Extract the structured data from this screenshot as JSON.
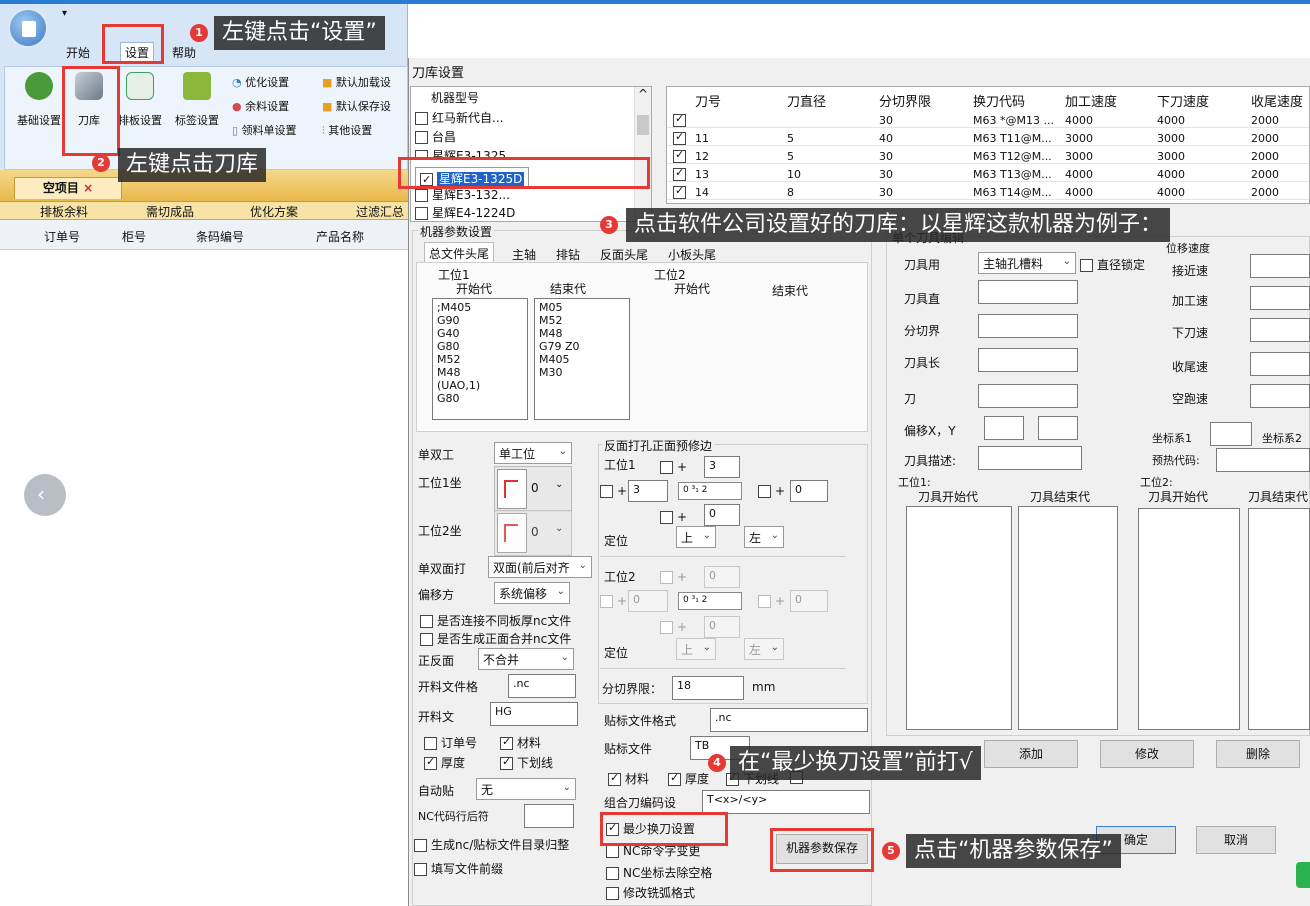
{
  "app": {
    "quick_access": "▾",
    "tabs": [
      "开始",
      "设置",
      "帮助"
    ],
    "ribbon": {
      "big_buttons": [
        {
          "label": "基础设置",
          "icon": "tools-icon",
          "color": "#4a9a3a"
        },
        {
          "label": "刀库",
          "icon": "cutter-icon",
          "color": "#6a7a8a"
        },
        {
          "label": "排板设置",
          "icon": "layout-icon",
          "color": "#3aa060"
        },
        {
          "label": "标签设置",
          "icon": "tag-icon",
          "color": "#8ab83a"
        }
      ],
      "small_buttons": [
        "优化设置",
        "余料设置",
        "领料单设置",
        "默认加载设",
        "默认保存设",
        "其他设置"
      ]
    },
    "doc_tab": {
      "label": "空项目",
      "close": "×"
    },
    "sub_tabs": [
      "排板余料",
      "需切成品",
      "优化方案",
      "过滤汇总"
    ],
    "columns": [
      "订单号",
      "柜号",
      "条码编号",
      "产品名称"
    ],
    "nav_prev": "‹"
  },
  "dialog": {
    "title": "刀库设置",
    "machine_list": {
      "header": "机器型号",
      "scroll_up": "^",
      "items": [
        {
          "label": "红马新代自...",
          "checked": false
        },
        {
          "label": "台昌",
          "checked": false
        },
        {
          "label": "星辉E3-1325",
          "checked": false
        },
        {
          "label": "星辉E3-1325D",
          "checked": true
        },
        {
          "label": "星辉E3-132...",
          "checked": false
        },
        {
          "label": "星辉E4-1224D",
          "checked": false
        }
      ]
    },
    "tool_grid": {
      "headers": [
        "刀号",
        "刀直径",
        "分切界限",
        "换刀代码",
        "加工速度",
        "下刀速度",
        "收尾速度"
      ],
      "rows": [
        {
          "checked": true,
          "no": "",
          "dia": "",
          "cut": "30",
          "code": "M63 *@M13 ...",
          "speed": "4000",
          "down": "4000",
          "end": "2000"
        },
        {
          "checked": true,
          "no": "11",
          "dia": "5",
          "cut": "40",
          "code": "M63 T11@M...",
          "speed": "3000",
          "down": "3000",
          "end": "2000"
        },
        {
          "checked": true,
          "no": "12",
          "dia": "5",
          "cut": "30",
          "code": "M63 T12@M...",
          "speed": "3000",
          "down": "3000",
          "end": "2000"
        },
        {
          "checked": true,
          "no": "13",
          "dia": "10",
          "cut": "30",
          "code": "M63 T13@M...",
          "speed": "4000",
          "down": "4000",
          "end": "2000"
        },
        {
          "checked": true,
          "no": "14",
          "dia": "8",
          "cut": "30",
          "code": "M63 T14@M...",
          "speed": "4000",
          "down": "4000",
          "end": "2000"
        }
      ]
    },
    "machine_params": {
      "title": "机器参数设置",
      "tabs": [
        "总文件头尾",
        "主轴",
        "排钻",
        "反面头尾",
        "小板头尾"
      ],
      "station1": "工位1",
      "station2": "工位2",
      "start_code": "开始代",
      "end_code": "结束代",
      "start_lines": ";M405\nG90\nG40\nG80\nM52\nM48\n(UAO,1)\nG80",
      "end_lines": "M05\nM52\nM48\nG79 Z0\nM405\nM30",
      "single_double_label": "单双工",
      "single_double_value": "单工位",
      "station1_coord": "工位1坐",
      "station2_coord": "工位2坐",
      "coord_value": "0",
      "face_label": "单双面打",
      "face_value": "双面(前后对齐",
      "offset_label": "偏移方",
      "offset_value": "系统偏移",
      "chk_connect": "是否连接不同板厚nc文件",
      "chk_merge": "是否生成正面合并nc文件",
      "front_back_label": "正反面",
      "front_back_value": "不合并",
      "open_fmt_label": "开料文件格",
      "open_fmt_value": ".nc",
      "open_file_label": "开料文",
      "open_file_value": "HG",
      "chk_order": "订单号",
      "chk_material": "材料",
      "chk_thickness": "厚度",
      "chk_underline": "下划线",
      "auto_label": "自动贴",
      "auto_value": "无",
      "nc_suffix_label": "NC代码行后符",
      "chk_gen_dir": "生成nc/贴标文件目录归整",
      "chk_prefix": "填写文件前缀"
    },
    "back_panel": {
      "title": "反面打孔正面预修边",
      "st1": "工位1",
      "st2": "工位2",
      "plus": "+",
      "v_top": "3",
      "v_left": "3",
      "v_right": "0",
      "v_bottom": "0",
      "ruler": "0   ³₁   2",
      "pos_label": "定位",
      "pos_up": "上",
      "pos_left": "左",
      "dis_0": "0",
      "split_label": "分切界限：",
      "split_value": "18",
      "split_unit": "mm",
      "label_fmt_label": "贴标文件格式",
      "label_fmt_value": ".nc",
      "label_file_label": "贴标文件",
      "label_file_value": "TB",
      "chk_material": "材料",
      "chk_thickness": "厚度",
      "chk_underline": "下划线",
      "chk_extra": "",
      "combo_label": "组合刀编码设",
      "combo_value": "T<x>/<y>",
      "chk_min_change": "最少换刀设置",
      "chk_cmd": "NC命令字变更",
      "chk_nc_space": "NC坐标去除空格",
      "chk_arc": "修改铣弧格式",
      "save_btn": "机器参数保存"
    },
    "tool_edit": {
      "title": "单个刀具编辑",
      "tool_use_label": "刀具用",
      "tool_use_value": "主轴孔槽料",
      "chk_lock": "直径锁定",
      "dia_label": "刀具直",
      "cut_label": "分切界",
      "len_label": "刀具长",
      "knife_label": "刀",
      "offset_label": "偏移X，Y",
      "desc_label": "刀具描述:",
      "speed_title": "位移速度",
      "approach": "接近速",
      "process": "加工速",
      "down": "下刀速",
      "tail": "收尾速",
      "idle": "空跑速",
      "coord1": "坐标系1",
      "coord2": "坐标系2",
      "preheat": "预热代码:",
      "st1": "工位1:",
      "st2": "工位2:",
      "tool_start": "刀具开始代",
      "tool_end": "刀具结束代",
      "add_btn": "添加",
      "modify_btn": "修改",
      "delete_btn": "删除",
      "ok_btn": "确定",
      "cancel_btn": "取消"
    }
  },
  "annotations": [
    {
      "n": "1",
      "text": "左键点击“设置”"
    },
    {
      "n": "2",
      "text": "左键点击刀库"
    },
    {
      "n": "3",
      "text": "点击软件公司设置好的刀库：以星辉这款机器为例子："
    },
    {
      "n": "4",
      "text": "在“最少换刀设置”前打√"
    },
    {
      "n": "5",
      "text": "点击“机器参数保存”"
    }
  ],
  "colors": {
    "accent_red": "#e53935",
    "ribbon_blue": "#d7e6f7",
    "tab_gold": "#e8b84a",
    "selection": "#1e64c8"
  }
}
